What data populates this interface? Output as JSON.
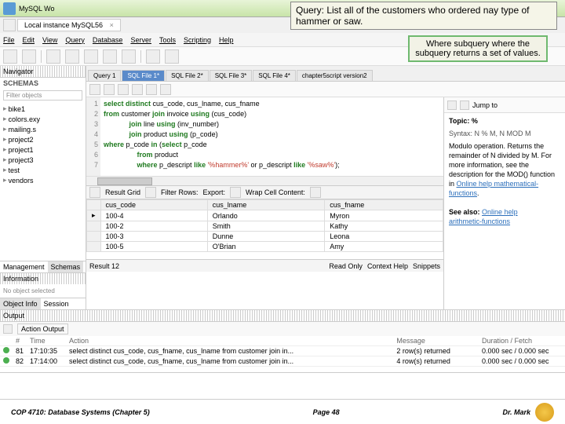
{
  "callouts": {
    "query": "Query:  List all of the customers who ordered nay type of hammer or saw.",
    "where": "Where subquery where the subquery returns a set of values."
  },
  "titlebar": {
    "title": "MySQL Wo"
  },
  "instance_tab": {
    "label": "Local instance MySQL56",
    "close": "×"
  },
  "menu": [
    "File",
    "Edit",
    "View",
    "Query",
    "Database",
    "Server",
    "Tools",
    "Scripting",
    "Help"
  ],
  "nav": {
    "title": "Navigator",
    "schemas": "SCHEMAS",
    "filter": "Filter objects",
    "tree": [
      "bike1",
      "colors.exy",
      "mailing.s",
      "project2",
      "project1",
      "project3",
      "test",
      "vendors"
    ],
    "tabs": {
      "mgmt": "Management",
      "sch": "Schemas"
    },
    "info": "Information",
    "noobj": "No object selected",
    "objinfo": "Object Info",
    "session": "Session"
  },
  "tabs": [
    "Query 1",
    "SQL File 1*",
    "SQL File 2*",
    "SQL File 3*",
    "SQL File 4*",
    "chapter5script version2"
  ],
  "sql": {
    "l1a": "select distinct",
    "l1b": " cus_code, cus_lname, cus_fname",
    "l2a": "from",
    "l2b": " customer ",
    "l2c": "join",
    "l2d": " invoice ",
    "l2e": "using",
    "l2f": " (cus_code)",
    "l3a": "join",
    "l3b": " line ",
    "l3c": "using",
    "l3d": " (inv_number)",
    "l4a": "join",
    "l4b": " product ",
    "l4c": "using",
    "l4d": " (p_code)",
    "l5a": "where",
    "l5b": " p_code ",
    "l5c": "in",
    "l5d": " (",
    "l5e": "select",
    "l5f": " p_code",
    "l6a": "from",
    "l6b": " product",
    "l7a": "where",
    "l7b": " p_descript ",
    "l7c": "like",
    "l7d": " ",
    "l7e": "'%hammer%'",
    "l7f": " or p_descript ",
    "l7g": "like",
    "l7h": " ",
    "l7i": "'%saw%'",
    "l7j": ");"
  },
  "gutter": [
    "1",
    "2",
    "3",
    "4",
    "5",
    "6",
    "7"
  ],
  "result": {
    "tabs": {
      "res": "Result Grid",
      "filter": "Filter Rows:",
      "export": "Export:",
      "wrap": "Wrap Cell Content:"
    },
    "cols": [
      "cus_code",
      "cus_lname",
      "cus_fname"
    ],
    "rows": [
      [
        "100-4",
        "Orlando",
        "Myron"
      ],
      [
        "100-2",
        "Smith",
        "Kathy"
      ],
      [
        "100-3",
        "Dunne",
        "Leona"
      ],
      [
        "100-5",
        "O'Brian",
        "Amy"
      ]
    ],
    "footer": {
      "label": "Result 12",
      "ro": "Read Only",
      "ctx": "Context Help",
      "snip": "Snippets"
    }
  },
  "help": {
    "jump": "Jump to",
    "topic_lbl": "Topic:",
    "topic": "%",
    "syntax": "Syntax: N % M, N MOD M",
    "desc": "Modulo operation. Returns the remainder of N divided by M. For more information, see the description for the MOD() function in ",
    "link1": "Online help mathematical-functions",
    "see": "See also:",
    "link2": "Online help",
    "link3": "arithmetic-functions"
  },
  "output": {
    "title": "Output",
    "selector": "Action Output",
    "cols": [
      "",
      "#",
      "Time",
      "Action",
      "Message",
      "Duration / Fetch"
    ],
    "rows": [
      [
        "ok",
        "81",
        "17:10:35",
        "select distinct cus_code, cus_fname, cus_lname from customer join in...",
        "2 row(s) returned",
        "0.000 sec / 0.000 sec"
      ],
      [
        "ok",
        "82",
        "17:14:00",
        "select distinct cus_code, cus_fname, cus_lname from customer join in...",
        "4 row(s) returned",
        "0.000 sec / 0.000 sec"
      ]
    ]
  },
  "slide": {
    "left": "COP 4710: Database Systems  (Chapter 5)",
    "mid": "Page 48",
    "right": "Dr. Mark"
  }
}
